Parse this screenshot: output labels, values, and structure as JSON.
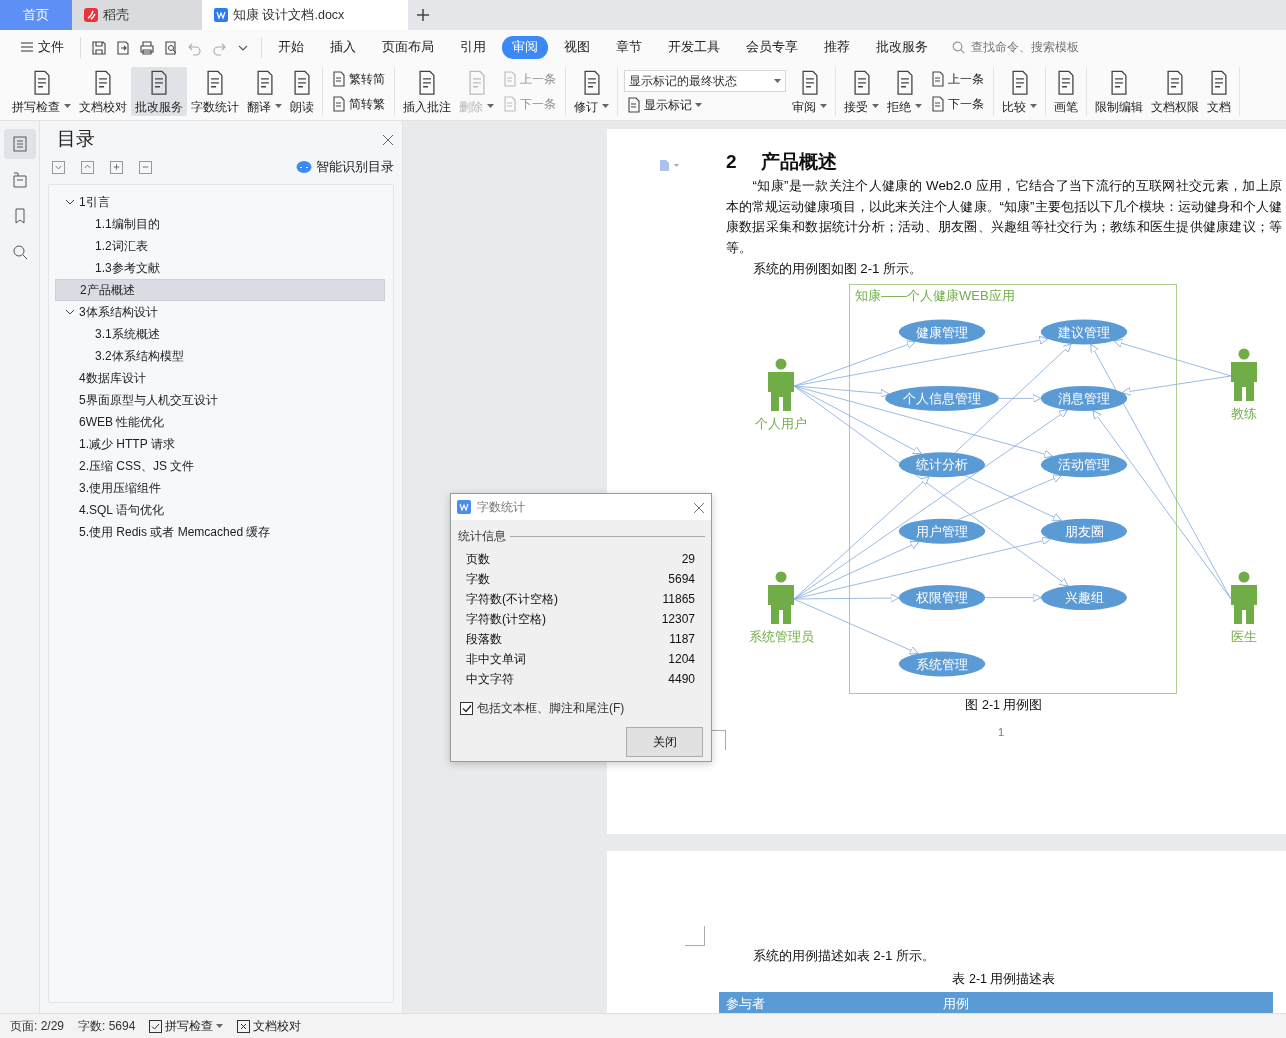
{
  "tabs": [
    {
      "label": "首页",
      "kind": "home",
      "selected": false
    },
    {
      "label": "稻壳",
      "kind": "docer",
      "selected": false
    },
    {
      "label": "知康 设计文档.docx",
      "kind": "document",
      "selected": true
    }
  ],
  "menu": {
    "file": "文件",
    "items": [
      {
        "label": "开始",
        "selected": false
      },
      {
        "label": "插入",
        "selected": false
      },
      {
        "label": "页面布局",
        "selected": false
      },
      {
        "label": "引用",
        "selected": false
      },
      {
        "label": "审阅",
        "selected": true
      },
      {
        "label": "视图",
        "selected": false
      },
      {
        "label": "章节",
        "selected": false
      },
      {
        "label": "开发工具",
        "selected": false
      },
      {
        "label": "会员专享",
        "selected": false
      },
      {
        "label": "推荐",
        "selected": false
      },
      {
        "label": "批改服务",
        "selected": false
      }
    ],
    "search": {
      "placeholder": "查找命令、搜索模板"
    }
  },
  "ribbon": [
    [
      {
        "kind": "large",
        "label": "拼写检查",
        "dropdown": true,
        "disabled": false,
        "pressed": false
      },
      {
        "kind": "large",
        "label": "文档校对",
        "dropdown": false,
        "disabled": false,
        "pressed": false
      },
      {
        "kind": "large",
        "label": "批改服务",
        "dropdown": false,
        "disabled": false,
        "pressed": true
      },
      {
        "kind": "large",
        "label": "字数统计",
        "dropdown": false,
        "disabled": false,
        "pressed": false
      },
      {
        "kind": "large",
        "label": "翻译",
        "dropdown": true,
        "disabled": false,
        "pressed": false
      },
      {
        "kind": "large",
        "label": "朗读",
        "dropdown": false,
        "disabled": false,
        "pressed": false
      }
    ],
    [
      {
        "kind": "stack",
        "items": [
          {
            "kind": "small",
            "label": "繁转简",
            "dropdown": false,
            "disabled": false
          },
          {
            "kind": "small",
            "label": "简转繁",
            "dropdown": false,
            "disabled": false
          }
        ]
      }
    ],
    [
      {
        "kind": "large",
        "label": "插入批注",
        "dropdown": false,
        "disabled": false,
        "pressed": false
      },
      {
        "kind": "large",
        "label": "删除",
        "dropdown": true,
        "disabled": true,
        "pressed": false
      },
      {
        "kind": "stack",
        "items": [
          {
            "kind": "small",
            "label": "上一条",
            "dropdown": false,
            "disabled": true
          },
          {
            "kind": "small",
            "label": "下一条",
            "dropdown": false,
            "disabled": true
          }
        ]
      }
    ],
    [
      {
        "kind": "large",
        "label": "修订",
        "dropdown": true,
        "disabled": false,
        "pressed": false
      }
    ],
    [
      {
        "kind": "stack",
        "items": [
          {
            "kind": "select",
            "label": "显示标记的最终状态",
            "dropdown": true,
            "disabled": false
          },
          {
            "kind": "small",
            "label": "显示标记",
            "dropdown": true,
            "disabled": false
          }
        ]
      },
      {
        "kind": "large",
        "label": "审阅",
        "dropdown": true,
        "disabled": false,
        "pressed": false
      }
    ],
    [
      {
        "kind": "large",
        "label": "接受",
        "dropdown": true,
        "disabled": false,
        "pressed": false
      },
      {
        "kind": "large",
        "label": "拒绝",
        "dropdown": true,
        "disabled": false,
        "pressed": false
      },
      {
        "kind": "stack",
        "items": [
          {
            "kind": "small",
            "label": "上一条",
            "dropdown": false,
            "disabled": false
          },
          {
            "kind": "small",
            "label": "下一条",
            "dropdown": false,
            "disabled": false
          }
        ]
      }
    ],
    [
      {
        "kind": "large",
        "label": "比较",
        "dropdown": true,
        "disabled": false,
        "pressed": false
      }
    ],
    [
      {
        "kind": "large",
        "label": "画笔",
        "dropdown": false,
        "disabled": false,
        "pressed": false
      }
    ],
    [
      {
        "kind": "large",
        "label": "限制编辑",
        "dropdown": false,
        "disabled": false,
        "pressed": false
      },
      {
        "kind": "large",
        "label": "文档权限",
        "dropdown": false,
        "disabled": false,
        "pressed": false
      },
      {
        "kind": "large",
        "label": "文档",
        "dropdown": false,
        "disabled": false,
        "pressed": false
      }
    ]
  ],
  "rail": [
    {
      "kind": "outline",
      "selected": true
    },
    {
      "kind": "chapters",
      "selected": false
    },
    {
      "kind": "bookmark",
      "selected": false
    },
    {
      "kind": "search",
      "selected": false
    }
  ],
  "sidebar": {
    "title": "目录",
    "smart_button": "智能识别目录",
    "items": [
      {
        "label": "1引言",
        "selected": false,
        "expanded": true,
        "children": [
          {
            "label": "1.1编制目的",
            "selected": false
          },
          {
            "label": "1.2词汇表",
            "selected": false
          },
          {
            "label": "1.3参考文献",
            "selected": false
          }
        ]
      },
      {
        "label": "2产品概述",
        "selected": true
      },
      {
        "label": "3体系结构设计",
        "selected": false,
        "expanded": true,
        "children": [
          {
            "label": "3.1系统概述",
            "selected": false
          },
          {
            "label": "3.2体系结构模型",
            "selected": false
          }
        ]
      },
      {
        "label": "4数据库设计",
        "selected": false
      },
      {
        "label": "5界面原型与人机交互设计",
        "selected": false
      },
      {
        "label": "6WEB 性能优化",
        "selected": false
      },
      {
        "label": "1.减少 HTTP 请求",
        "selected": false
      },
      {
        "label": "2.压缩 CSS、JS 文件",
        "selected": false
      },
      {
        "label": "3.使用压缩组件",
        "selected": false
      },
      {
        "label": "4.SQL 语句优化",
        "selected": false
      },
      {
        "label": "5.使用 Redis 或者 Memcached 缓存",
        "selected": false
      }
    ]
  },
  "document": {
    "heading_number": "2",
    "heading": "产品概述",
    "paragraphs": [
      "“知康”是一款关注个人健康的 Web2.0 应用，它结合了当下流行的互联网社交元素，加上原本的常规运动健康项目，以此来关注个人健康。“知康”主要包括以下几个模块：运动健身和个人健康数据采集和数据统计分析；活动、朋友圈、兴趣组等社交行为；教练和医生提供健康建议；等等。",
      "系统的用例图如图 2-1 所示。"
    ],
    "diagram": {
      "system_title": "知康——个人健康WEB应用",
      "left_actors": [
        "个人用户",
        "系统管理员"
      ],
      "right_actors": [
        "教练",
        "医生"
      ],
      "left_use_cases": [
        "健康管理",
        "个人信息管理",
        "统计分析",
        "用户管理",
        "权限管理",
        "系统管理"
      ],
      "right_use_cases": [
        "建议管理",
        "消息管理",
        "活动管理",
        "朋友圈",
        "兴趣组"
      ]
    },
    "figure_caption": "图 2-1  用例图",
    "page_number": "1",
    "page2_paragraph": "系统的用例描述如表 2-1 所示。",
    "table_caption": "表 2-1  用例描述表",
    "table_columns": [
      "参与者",
      "用例"
    ]
  },
  "dialog": {
    "title": "字数统计",
    "section": "统计信息",
    "rows": [
      {
        "label": "页数",
        "value": "29"
      },
      {
        "label": "字数",
        "value": "5694"
      },
      {
        "label": "字符数(不计空格)",
        "value": "11865"
      },
      {
        "label": "字符数(计空格)",
        "value": "12307"
      },
      {
        "label": "段落数",
        "value": "1187"
      },
      {
        "label": "非中文单词",
        "value": "1204"
      },
      {
        "label": "中文字符",
        "value": "4490"
      }
    ],
    "checkbox": {
      "label": "包括文本框、脚注和尾注(F)",
      "checked": true
    },
    "button": "关闭"
  },
  "status_bar": [
    {
      "kind": "text",
      "label": "页面: 2/29"
    },
    {
      "kind": "text",
      "label": "字数: 5694"
    },
    {
      "kind": "spell",
      "label": "拼写检查",
      "dropdown": true
    },
    {
      "kind": "proofread",
      "label": "文档校对",
      "dropdown": false
    }
  ]
}
